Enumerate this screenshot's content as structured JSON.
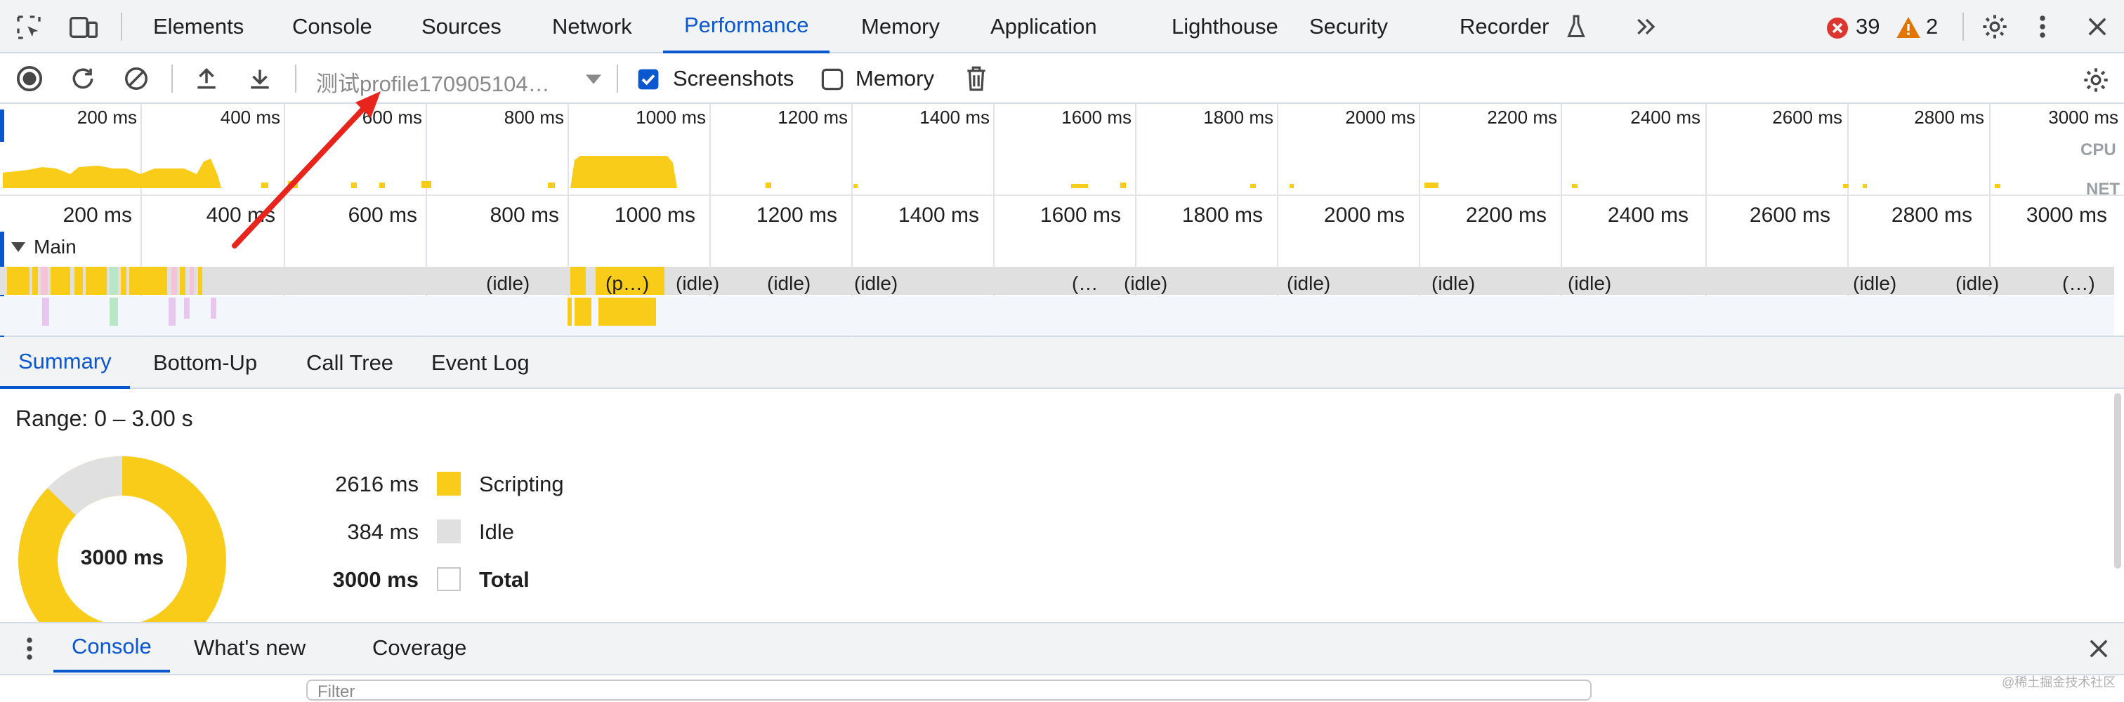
{
  "tabbar": {
    "tabs": [
      "Elements",
      "Console",
      "Sources",
      "Network",
      "Performance",
      "Memory",
      "Application",
      "Lighthouse",
      "Security",
      "Recorder"
    ],
    "active_tab": "Performance",
    "error_count": "39",
    "warning_count": "2"
  },
  "toolbar": {
    "profile_select": "测试profile170905104…",
    "screenshots_label": "Screenshots",
    "screenshots_checked": true,
    "memory_label": "Memory",
    "memory_checked": false
  },
  "overview": {
    "ticks": [
      "200 ms",
      "400 ms",
      "600 ms",
      "800 ms",
      "1000 ms",
      "1200 ms",
      "1400 ms",
      "1600 ms",
      "1800 ms",
      "2000 ms",
      "2200 ms",
      "2400 ms",
      "2600 ms",
      "2800 ms",
      "3000 ms"
    ],
    "cpu_label": "CPU",
    "net_label": "NET"
  },
  "flame": {
    "ticks": [
      "200 ms",
      "400 ms",
      "600 ms",
      "800 ms",
      "1000 ms",
      "1200 ms",
      "1400 ms",
      "1600 ms",
      "1800 ms",
      "2000 ms",
      "2200 ms",
      "2400 ms",
      "2600 ms",
      "2800 ms",
      "3000 ms"
    ],
    "main_label": "Main",
    "task_labels": [
      "(idle)",
      "(p…)",
      "(idle)",
      "(idle)",
      "(idle)",
      "(…",
      "(idle)",
      "(idle)",
      "(idle)",
      "(idle)",
      "(idle)",
      "(idle)",
      "(…)"
    ]
  },
  "bottom_tabs": [
    "Summary",
    "Bottom-Up",
    "Call Tree",
    "Event Log"
  ],
  "summary": {
    "range": "Range: 0 – 3.00 s",
    "total_center": "3000 ms",
    "rows": [
      {
        "value": "2616 ms",
        "label": "Scripting",
        "color": "#f9cc1a"
      },
      {
        "value": "384 ms",
        "label": "Idle",
        "color": "#e0e0e0"
      },
      {
        "value": "3000 ms",
        "label": "Total",
        "color": "#ffffff"
      }
    ],
    "donut": {
      "scripting_ms": 2616,
      "idle_ms": 384
    }
  },
  "drawer": {
    "tabs": [
      "Console",
      "What's new",
      "Coverage"
    ],
    "filter_placeholder": "Filter",
    "watermark": "@稀土掘金技术社区"
  },
  "colors": {
    "accent": "#0b57d0",
    "scripting": "#f9cc1a",
    "idle": "#e0e0e0",
    "error": "#dc362e",
    "warning": "#e37400",
    "arrow": "#e8241c"
  }
}
